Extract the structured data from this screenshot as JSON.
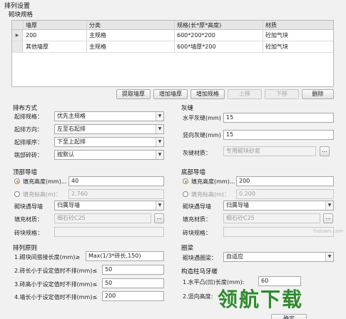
{
  "title": "排列设置",
  "spec": {
    "label": "砌块规格",
    "columns": [
      "墙厚",
      "分类",
      "规格(长*厚*高度)",
      "材质"
    ],
    "rows": [
      [
        "200",
        "主规格",
        "600*200*200",
        "砼加气块"
      ],
      [
        "其他墙厚",
        "主规格",
        "600*墙厚*200",
        "砼加气块"
      ]
    ],
    "buttons": {
      "extract": "提取墙厚",
      "add_wall": "增加墙厚",
      "add_spec": "增加规格",
      "up": "上移",
      "down": "下移",
      "delete": "删除"
    }
  },
  "layout": {
    "label": "排布方式",
    "start_spec": {
      "label": "起排规格：",
      "value": "优先主规格"
    },
    "start_dir": {
      "label": "起排方向：",
      "value": "左至右起排"
    },
    "start_order": {
      "label": "起排顺序：",
      "value": "下至上起排"
    },
    "brick": {
      "label": "跳部碎砖：",
      "value": "按默认"
    }
  },
  "mortar": {
    "label": "灰缝",
    "horizontal": {
      "label": "水平灰缝(mm)",
      "value": "15"
    },
    "vertical": {
      "label": "竖向灰缝(mm)",
      "value": "15"
    },
    "material": {
      "label": "灰缝材质：",
      "value": "专用砌块砂浆"
    }
  },
  "top_wall": {
    "label": "顶部导墙",
    "fill_height": {
      "label": "填充高度(mm)...",
      "value": "40"
    },
    "fill_elev": {
      "label": "填充标高(m)：",
      "value": "2.760"
    },
    "block_wall": {
      "label": "砌块遇导墙",
      "value": "归属导墙"
    },
    "fill_mat": {
      "label": "填充材质：",
      "value": "细石砼C25"
    },
    "brick_spec": {
      "label": "砖块规格：",
      "value": ""
    }
  },
  "bottom_wall": {
    "label": "底部导墙",
    "fill_height": {
      "label": "填充高度(mm)...",
      "value": "200"
    },
    "fill_elev": {
      "label": "填充标高(m)：",
      "value": "0.200"
    },
    "block_wall": {
      "label": "砌块遇导墙",
      "value": "归属导墙"
    },
    "fill_mat": {
      "label": "填充材质：",
      "value": "细石砼C25"
    },
    "brick_spec": {
      "label": "砖块规格：",
      "value": ""
    }
  },
  "rules": {
    "label": "排列原则",
    "r1": {
      "label": "1.砌块间搭接长度(mm)≥",
      "value": "Max(1/3*砖长,150)"
    },
    "r2": {
      "label": "2.砖长小于设定值时不排(mm)≤",
      "value": "50"
    },
    "r3": {
      "label": "3.砖高小于设定值时不排(mm)≤",
      "value": "50"
    },
    "r4": {
      "label": "4.墙长小于设定值时不排(mm)≤",
      "value": "200"
    }
  },
  "beam": {
    "label": "圈梁",
    "block_beam": {
      "label": "砌块遇圈梁：",
      "value": "自适应"
    }
  },
  "column": {
    "label": "构造柱马牙槎",
    "h1": {
      "label": "1.水平凸(凹)长度(mm):",
      "value": "60"
    },
    "h2": {
      "label": "2.竖向高度:",
      "value": ""
    }
  },
  "watermark": {
    "big": "领航下载",
    "small": "lhdown.com"
  },
  "footer": {
    "ok": "确定"
  }
}
